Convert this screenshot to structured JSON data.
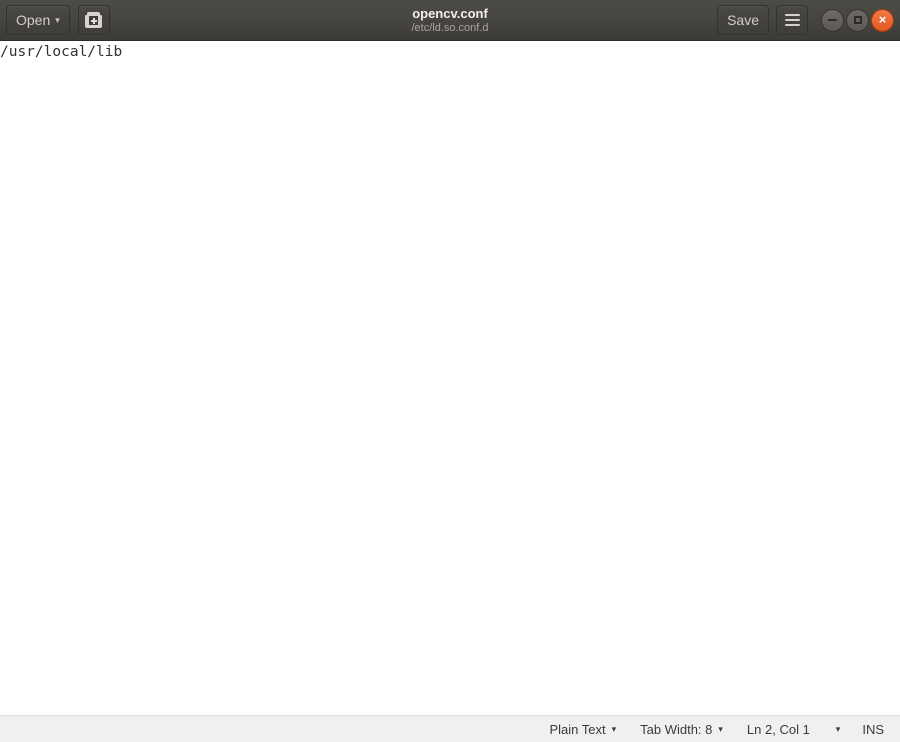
{
  "header": {
    "open_label": "Open",
    "open_caret": "▾",
    "saveas_icon_name": "save-as-icon",
    "title": "opencv.conf",
    "subtitle": "/etc/ld.so.conf.d",
    "save_label": "Save",
    "menu_icon_name": "hamburger-menu-icon",
    "window_controls": {
      "minimize_glyph": "−",
      "maximize_glyph": "□",
      "close_glyph": "×"
    },
    "colors": {
      "bar_top": "#4d4b46",
      "bar_bottom": "#3d3b37",
      "title_text": "#f2efe9",
      "subtitle_text": "#a9a49c",
      "close_button": "#e25822"
    }
  },
  "editor": {
    "lines": [
      "/usr/local/lib"
    ],
    "background": "#ffffff",
    "text_color": "#2e3436"
  },
  "statusbar": {
    "language_label": "Plain Text",
    "language_caret": "▾",
    "tab_width_label": "Tab Width: 8",
    "tab_width_caret": "▾",
    "position_label": "Ln 2, Col 1",
    "position_caret": "▾",
    "insert_mode_label": "INS",
    "background": "#f1f0ee",
    "text_color": "#3b3b39"
  }
}
